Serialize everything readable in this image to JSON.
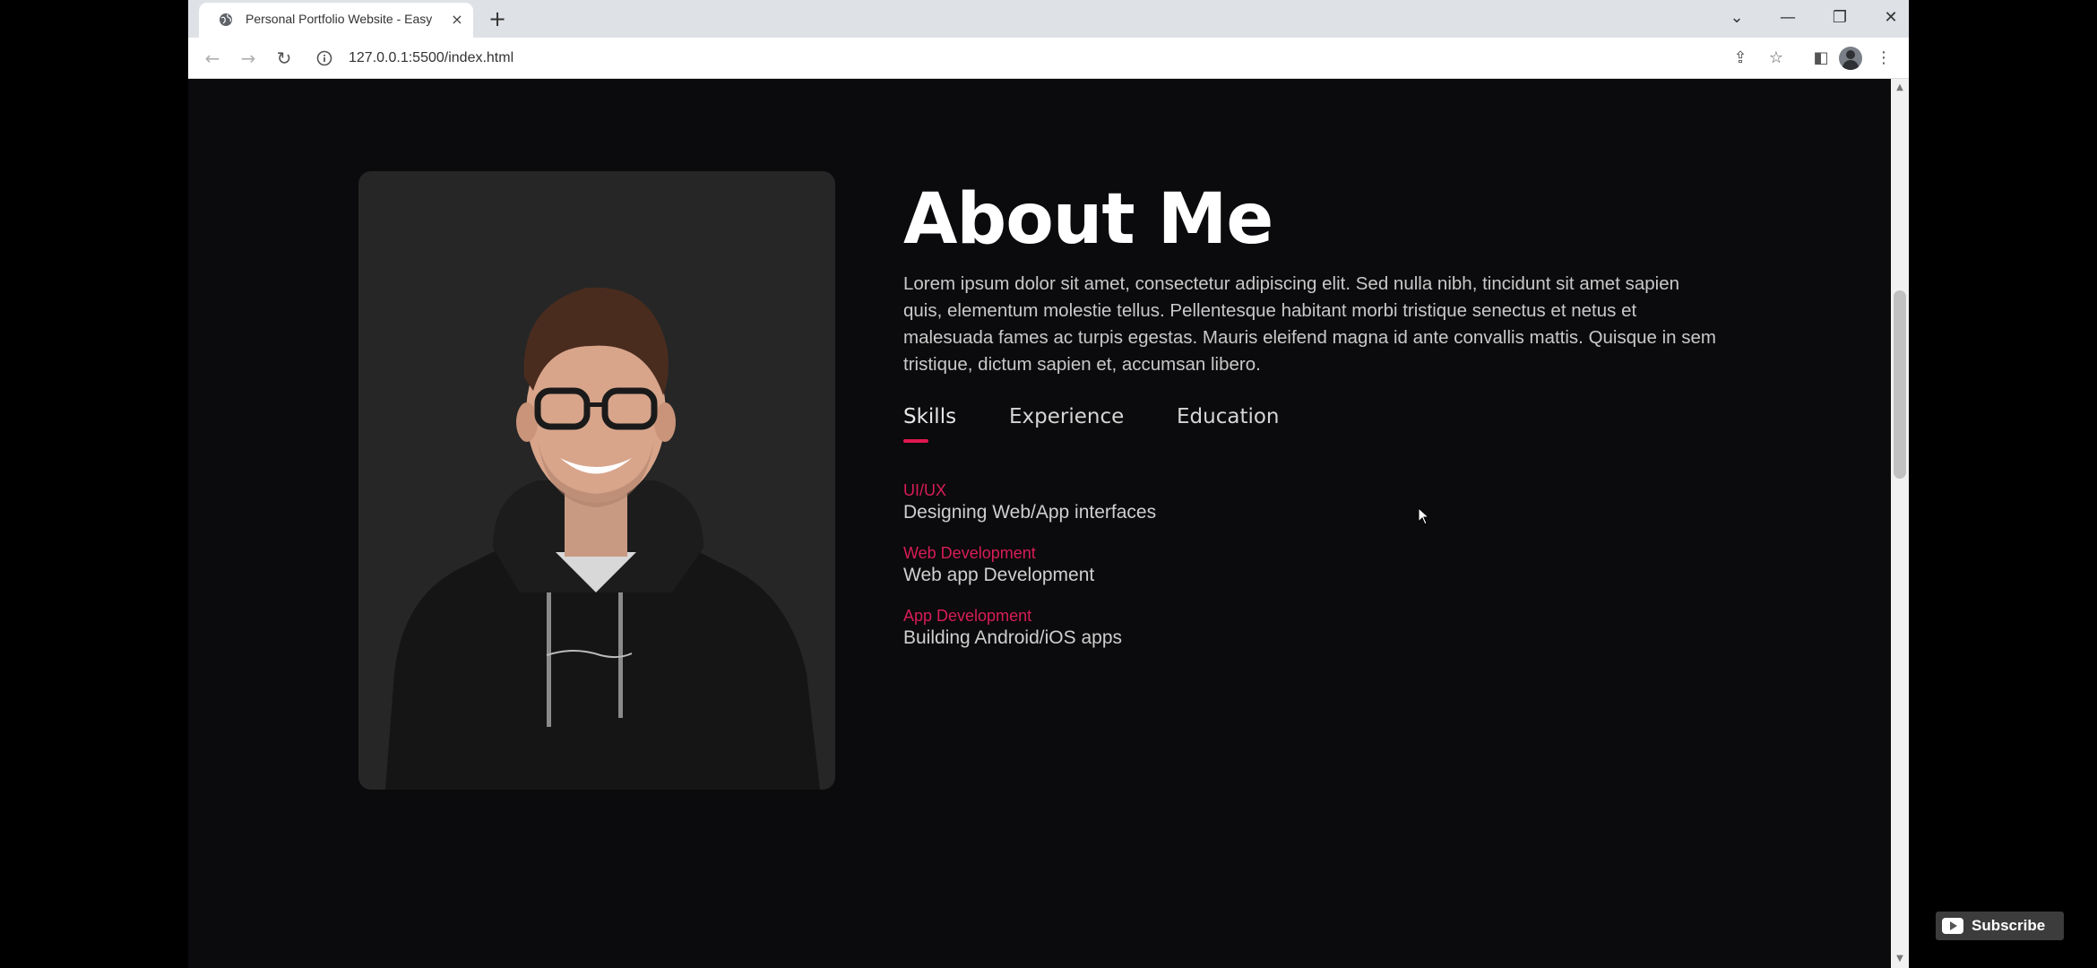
{
  "browser": {
    "tab": {
      "title": "Personal Portfolio Website - Easy",
      "close_glyph": "×"
    },
    "new_tab_glyph": "+",
    "window_controls": {
      "list": "⌄",
      "minimize": "—",
      "restore": "❐",
      "close": "✕"
    },
    "nav": {
      "back": "←",
      "forward": "→",
      "reload": "↻"
    },
    "url": "127.0.0.1:5500/index.html",
    "toolbar_icons": {
      "share": "⇪",
      "bookmark": "☆",
      "sidebar": "◧",
      "menu": "⋮"
    }
  },
  "about": {
    "title": "About Me",
    "description": "Lorem ipsum dolor sit amet, consectetur adipiscing elit. Sed nulla nibh, tincidunt sit amet sapien quis, elementum molestie tellus. Pellentesque habitant morbi tristique senectus et netus et malesuada fames ac turpis egestas. Mauris eleifend magna id ante convallis mattis. Quisque in sem tristique, dictum sapien et, accumsan libero.",
    "tabs": [
      {
        "label": "Skills",
        "active": true
      },
      {
        "label": "Experience",
        "active": false
      },
      {
        "label": "Education",
        "active": false
      }
    ],
    "skills": [
      {
        "title": "UI/UX",
        "description": "Designing Web/App interfaces"
      },
      {
        "title": "Web Development",
        "description": "Web app Development"
      },
      {
        "title": "App Development",
        "description": "Building Android/iOS apps"
      }
    ]
  },
  "overlay": {
    "subscribe_label": "Subscribe"
  },
  "colors": {
    "accent": "#d81d57",
    "page_bg": "#0b0a0c",
    "card_bg": "#262626"
  }
}
